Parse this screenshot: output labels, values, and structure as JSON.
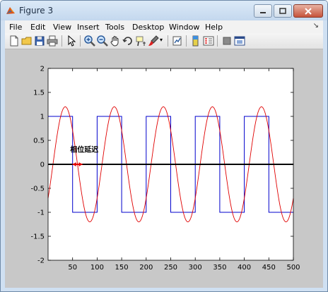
{
  "window": {
    "title": "Figure 3"
  },
  "menubar": {
    "items": [
      "File",
      "Edit",
      "View",
      "Insert",
      "Tools",
      "Desktop",
      "Window",
      "Help"
    ],
    "overflow_icon": "arrow-icon"
  },
  "toolbar": {
    "icons": [
      "new-figure-icon",
      "open-file-icon",
      "save-icon",
      "print-icon",
      "edit-plot-arrow-icon",
      "zoom-in-icon",
      "zoom-out-icon",
      "pan-hand-icon",
      "rotate-3d-icon",
      "data-cursor-icon",
      "brush-icon",
      "link-plot-icon",
      "insert-colorbar-icon",
      "insert-legend-icon",
      "hide-plot-tools-icon",
      "show-plot-tools-icon"
    ]
  },
  "chart_data": {
    "type": "line",
    "title": "",
    "xlabel": "",
    "ylabel": "",
    "xlim": [
      0,
      500
    ],
    "ylim": [
      -2,
      2
    ],
    "xticks": [
      50,
      100,
      150,
      200,
      250,
      300,
      350,
      400,
      450,
      500
    ],
    "yticks": [
      2,
      1.5,
      1,
      0.5,
      0,
      -0.5,
      -1,
      -1.5,
      -2
    ],
    "xtick_labels": [
      "50",
      "100",
      "150",
      "200",
      "250",
      "300",
      "350",
      "400",
      "450",
      "500"
    ],
    "ytick_labels": [
      "2",
      "1.5",
      "1",
      "0.5",
      "0",
      "-0.5",
      "-1",
      "-1.5",
      "-2"
    ],
    "grid": false,
    "series": [
      {
        "color": "#0000cc",
        "kind": "square-wave",
        "x": [
          0,
          50,
          50,
          100,
          100,
          150,
          150,
          200,
          200,
          250,
          250,
          300,
          300,
          350,
          350,
          400,
          400,
          450,
          450,
          500
        ],
        "y": [
          1,
          1,
          -1,
          -1,
          1,
          1,
          -1,
          -1,
          1,
          1,
          -1,
          -1,
          1,
          1,
          -1,
          -1,
          1,
          1,
          -1,
          -1
        ]
      },
      {
        "color": "#e00000",
        "kind": "sine",
        "amplitude": 1.2,
        "period": 100,
        "phase_delay": 10,
        "x_start": 0,
        "x_end": 500
      },
      {
        "color": "#000000",
        "kind": "zero-line",
        "x": [
          0,
          500
        ],
        "y": [
          0,
          0
        ]
      }
    ],
    "annotations": [
      {
        "text": "相位延迟",
        "x": 45,
        "y": 0.3
      },
      {
        "kind": "double-arrow",
        "color": "#e00000",
        "x1": 50,
        "x2": 70,
        "y": 0
      }
    ]
  }
}
